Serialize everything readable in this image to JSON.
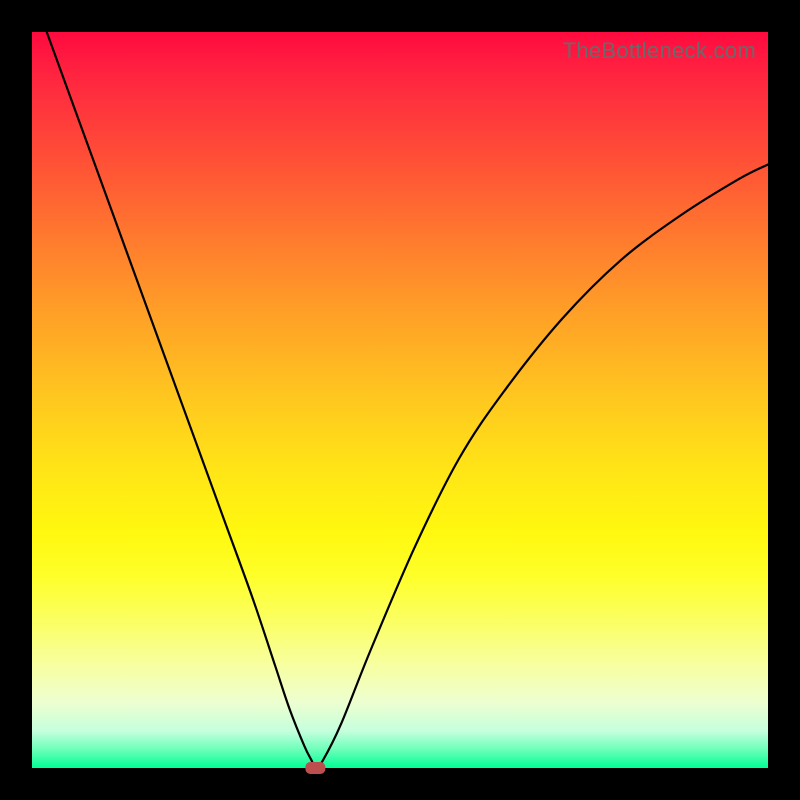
{
  "watermark": "TheBottleneck.com",
  "colors": {
    "frame": "#000000",
    "curve": "#000000",
    "marker": "#bd4e4e",
    "gradient_top": "#ff0a3f",
    "gradient_bottom": "#00ff94"
  },
  "chart_data": {
    "type": "line",
    "title": "",
    "xlabel": "",
    "ylabel": "",
    "xlim": [
      0,
      100
    ],
    "ylim": [
      0,
      100
    ],
    "grid": false,
    "legend": false,
    "series": [
      {
        "name": "bottleneck-curve",
        "x": [
          2,
          6,
          10,
          14,
          18,
          22,
          26,
          30,
          33,
          35,
          37,
          38,
          38.5,
          39.5,
          42,
          46,
          52,
          58,
          64,
          72,
          80,
          88,
          96,
          100
        ],
        "y": [
          100,
          89,
          78,
          67,
          56,
          45,
          34,
          23,
          14,
          8,
          3,
          1,
          0,
          1,
          6,
          16,
          30,
          42,
          51,
          61,
          69,
          75,
          80,
          82
        ]
      }
    ],
    "marker": {
      "x": 38.5,
      "y": 0,
      "shape": "rounded-rect",
      "color": "#bd4e4e"
    }
  }
}
